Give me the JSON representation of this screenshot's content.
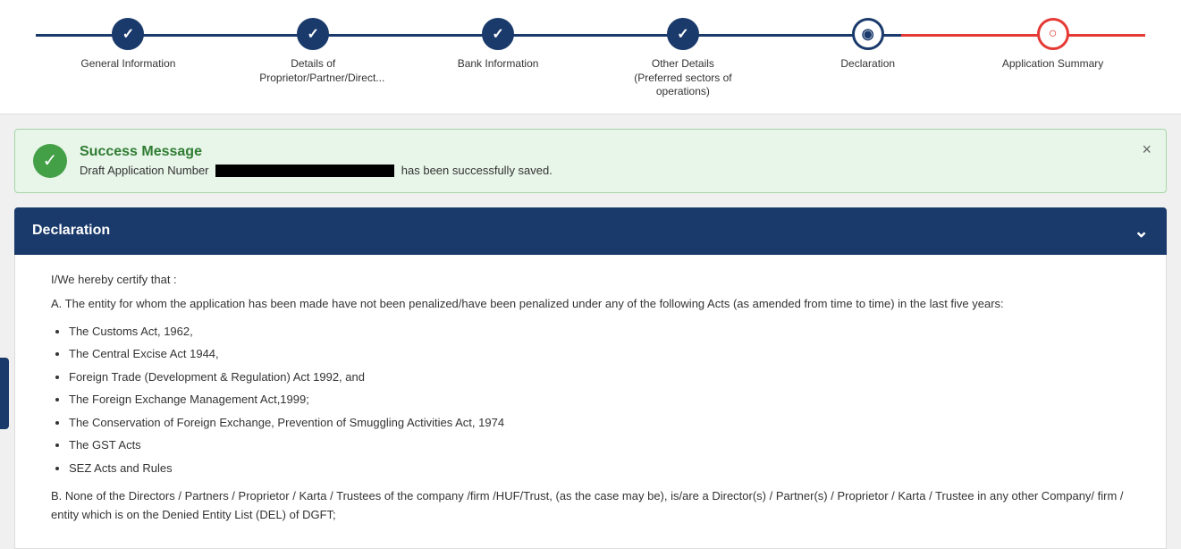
{
  "progress": {
    "steps": [
      {
        "id": "general-info",
        "label": "General Information",
        "state": "completed"
      },
      {
        "id": "proprietor-details",
        "label": "Details of Proprietor/Partner/Direct...",
        "state": "completed"
      },
      {
        "id": "bank-info",
        "label": "Bank Information",
        "state": "completed"
      },
      {
        "id": "other-details",
        "label": "Other Details (Preferred sectors of operations)",
        "state": "completed"
      },
      {
        "id": "declaration",
        "label": "Declaration",
        "state": "active"
      },
      {
        "id": "application-summary",
        "label": "Application Summary",
        "state": "pending"
      }
    ]
  },
  "success": {
    "title": "Success Message",
    "body_prefix": "Draft Application Number",
    "body_suffix": "has been successfully saved.",
    "close_label": "×"
  },
  "declaration": {
    "title": "Declaration",
    "chevron": "⌄",
    "certify_text": "I/We hereby certify that :",
    "section_a": "A. The entity for whom the application has been made have not been penalized/have been penalized under any of the following Acts (as amended from time to time) in the last five years:",
    "acts": [
      "The Customs Act, 1962,",
      "The Central Excise Act 1944,",
      "Foreign Trade (Development & Regulation) Act 1992, and",
      "The Foreign Exchange Management Act,1999;",
      "The Conservation of Foreign Exchange, Prevention of Smuggling Activities Act, 1974",
      "The GST Acts",
      "SEZ Acts and Rules"
    ],
    "section_b": "B. None of the Directors / Partners / Proprietor / Karta / Trustees of the company /firm /HUF/Trust, (as the case may be), is/are a Director(s) / Partner(s) / Proprietor / Karta / Trustee in any other Company/ firm / entity which is on the Denied Entity List (DEL) of DGFT;"
  }
}
